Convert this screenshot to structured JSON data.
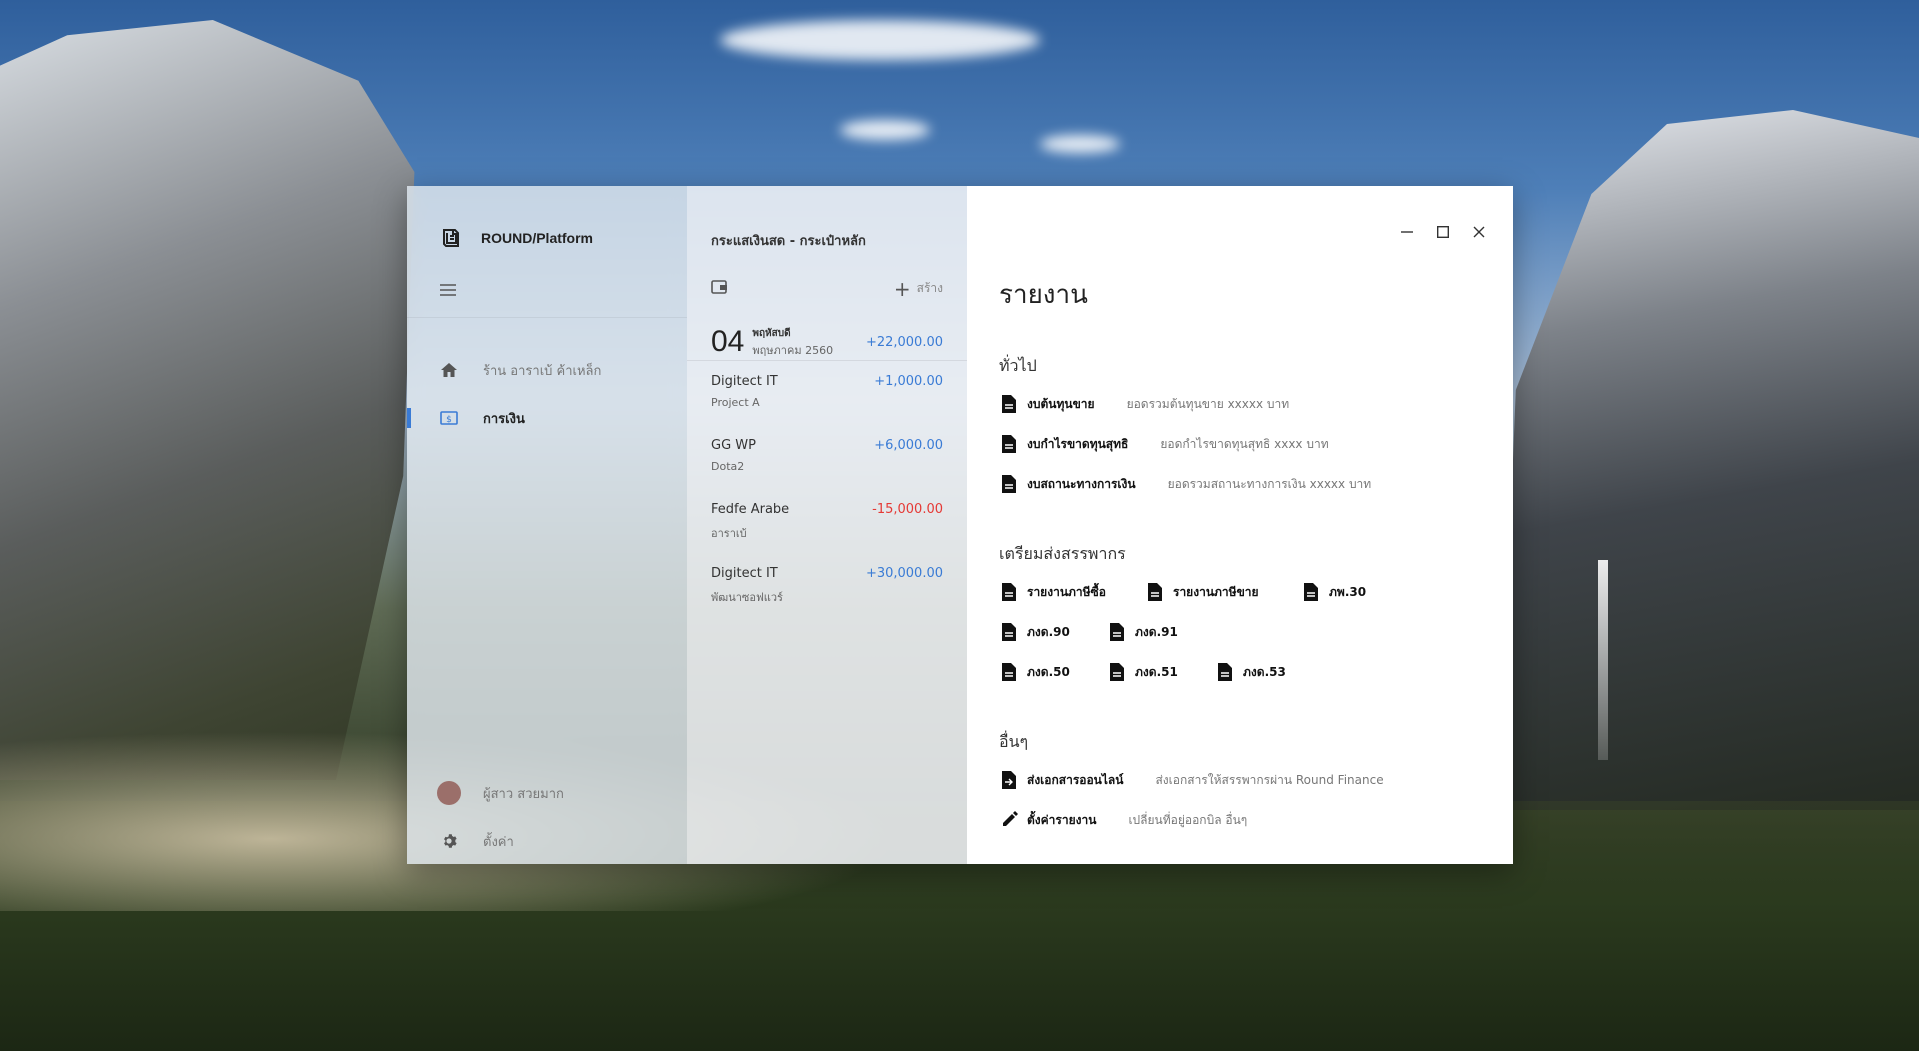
{
  "app": {
    "brand_name": "ROUND/Platform"
  },
  "nav": {
    "items": [
      {
        "label": "ร้าน อาราเบ้ ค้าเหล็ก",
        "icon": "home-icon"
      },
      {
        "label": "การเงิน",
        "icon": "dollar-icon",
        "active": true
      }
    ],
    "user_name": "ผู้สาว สวยมาก",
    "settings_label": "ตั้งค่า"
  },
  "list": {
    "header": "กระแสเงินสด  -  กระเป๋าหลัก",
    "create_label": "สร้าง",
    "date_group": {
      "day": "04",
      "weekday": "พฤหัสบดี",
      "month_year": "พฤษภาคม 2560",
      "total": "+22,000.00"
    },
    "transactions": [
      {
        "name": "Digitect IT",
        "sub": "Project A",
        "amount": "+1,000.00",
        "sign": "pos"
      },
      {
        "name": "GG WP",
        "sub": "Dota2",
        "amount": "+6,000.00",
        "sign": "pos"
      },
      {
        "name": "Fedfe Arabe",
        "sub": "อาราเบ้",
        "amount": "-15,000.00",
        "sign": "neg"
      },
      {
        "name": "Digitect IT",
        "sub": "พัฒนาซอฟแวร์",
        "amount": "+30,000.00",
        "sign": "pos"
      }
    ]
  },
  "main": {
    "title": "รายงาน",
    "sections": {
      "general": {
        "title": "ทั่วไป",
        "items": [
          {
            "name": "งบต้นทุนขาย",
            "desc": "ยอดรวมต้นทุนขาย xxxxx บาท"
          },
          {
            "name": "งบกำไรขาดทุนสุทธิ",
            "desc": "ยอดกำไรขาดทุนสุทธิ xxxx บาท"
          },
          {
            "name": "งบสถานะทางการเงิน",
            "desc": "ยอดรวมสถานะทางการเงิน xxxxx บาท"
          }
        ]
      },
      "tax": {
        "title": "เตรียมส่งสรรพากร",
        "items": [
          "รายงานภาษีซื้อ",
          "รายงานภาษีขาย",
          "ภพ.30",
          "ภงด.90",
          "ภงด.91",
          "ภงด.50",
          "ภงด.51",
          "ภงด.53"
        ]
      },
      "other": {
        "title": "อื่นๆ",
        "items": [
          {
            "name": "ส่งเอกสารออนไลน์",
            "desc": "ส่งเอกสารให้สรรพากรผ่าน Round Finance",
            "icon": "upload-document-icon"
          },
          {
            "name": "ตั้งค่ารายงาน",
            "desc": "เปลี่ยนที่อยู่ออกบิล อื่นๆ",
            "icon": "pencil-icon"
          }
        ]
      }
    }
  },
  "colors": {
    "accent": "#3a7bd5",
    "negative": "#e53935"
  }
}
